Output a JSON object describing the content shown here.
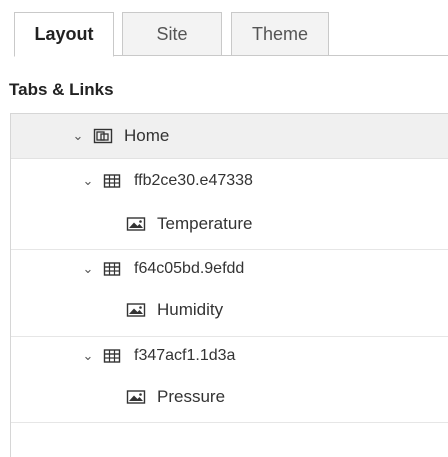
{
  "tabs": [
    {
      "label": "Layout",
      "active": true
    },
    {
      "label": "Site",
      "active": false
    },
    {
      "label": "Theme",
      "active": false
    }
  ],
  "section_title": "Tabs & Links",
  "tree": {
    "home": {
      "label": "Home",
      "icon": "tab-icon",
      "expanded": true
    },
    "groups": [
      {
        "label": "ffb2ce30.e47338",
        "icon": "table-icon",
        "expanded": true,
        "widgets": [
          {
            "label": "Temperature",
            "icon": "image-icon"
          }
        ]
      },
      {
        "label": "f64c05bd.9efdd",
        "icon": "table-icon",
        "expanded": true,
        "widgets": [
          {
            "label": "Humidity",
            "icon": "image-icon"
          }
        ]
      },
      {
        "label": "f347acf1.1d3a",
        "icon": "table-icon",
        "expanded": true,
        "widgets": [
          {
            "label": "Pressure",
            "icon": "image-icon"
          }
        ]
      }
    ]
  },
  "colors": {
    "border": "#c9c9c9",
    "home_row_bg": "#f0f0f0",
    "text": "#333333"
  }
}
